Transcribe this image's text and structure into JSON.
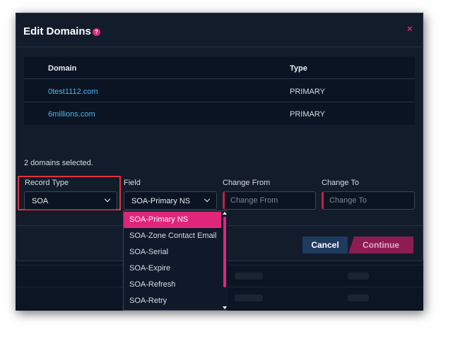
{
  "modal": {
    "title": "Edit Domains",
    "help_icon": "?",
    "close_icon": "×"
  },
  "table": {
    "headers": {
      "domain": "Domain",
      "type": "Type"
    },
    "rows": [
      {
        "domain": "0test1112.com",
        "type": "PRIMARY"
      },
      {
        "domain": "6millions.com",
        "type": "PRIMARY"
      }
    ]
  },
  "selection": {
    "count_text": "2 domains selected."
  },
  "form": {
    "record_type": {
      "label": "Record Type",
      "value": "SOA"
    },
    "field": {
      "label": "Field",
      "value": "SOA-Primary NS"
    },
    "change_from": {
      "label": "Change From",
      "placeholder": "Change From"
    },
    "change_to": {
      "label": "Change To",
      "placeholder": "Change To"
    }
  },
  "dropdown": {
    "options": [
      "SOA-Primary NS",
      "SOA-Zone Contact Email",
      "SOA-Serial",
      "SOA-Expire",
      "SOA-Refresh",
      "SOA-Retry"
    ],
    "active_index": 0
  },
  "footer": {
    "cancel_label": "Cancel",
    "continue_label": "Continue"
  },
  "colors": {
    "accent": "#e0267b",
    "link": "#4fb3f2",
    "cancel_bg": "#1f3a5f",
    "continue_bg": "#8c1c52",
    "highlight": "#e0323a"
  }
}
